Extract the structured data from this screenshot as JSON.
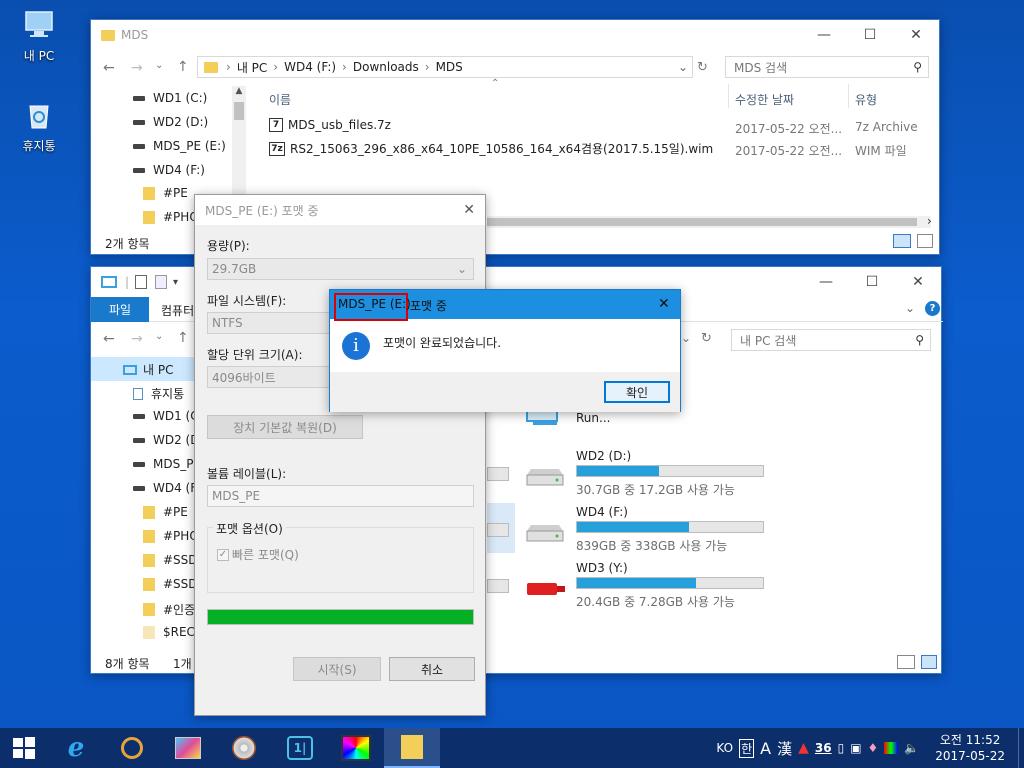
{
  "desktop": {
    "icons": [
      {
        "label": "내 PC",
        "icon": "computer-icon"
      },
      {
        "label": "휴지통",
        "icon": "recycle-bin-icon"
      }
    ]
  },
  "window_mds": {
    "title": "MDS",
    "breadcrumb": [
      "내 PC",
      "WD4 (F:)",
      "Downloads",
      "MDS"
    ],
    "search_placeholder": "MDS 검색",
    "tree": [
      {
        "label": "WD1 (C:)",
        "type": "drive"
      },
      {
        "label": "WD2 (D:)",
        "type": "drive"
      },
      {
        "label": "MDS_PE (E:)",
        "type": "drive"
      },
      {
        "label": "WD4 (F:)",
        "type": "drive"
      },
      {
        "label": "#PE",
        "type": "folder"
      },
      {
        "label": "#PHOT",
        "type": "folder"
      }
    ],
    "columns": {
      "name": "이름",
      "modified": "수정한 날짜",
      "type": "유형"
    },
    "files": [
      {
        "name": "MDS_usb_files.7z",
        "modified": "2017-05-22 오전...",
        "type": "7z Archive",
        "icon_text": "7"
      },
      {
        "name": "RS2_15063_296_x86_x64_10PE_10586_164_x64겸용(2017.5.15일).wim",
        "modified": "2017-05-22 오전...",
        "type": "WIM 파일",
        "icon_text": "7z"
      }
    ],
    "status": "2개 항목"
  },
  "window_mypc": {
    "ribbon_tabs": [
      "파일",
      "컴퓨터"
    ],
    "search_placeholder": "내 PC 검색",
    "tree": [
      {
        "label": "내 PC",
        "type": "pc"
      },
      {
        "label": "휴지통",
        "type": "bin"
      },
      {
        "label": "WD1 (C",
        "type": "drive"
      },
      {
        "label": "WD2 (D",
        "type": "drive"
      },
      {
        "label": "MDS_PE",
        "type": "drive"
      },
      {
        "label": "WD4 (F:",
        "type": "drive"
      },
      {
        "label": "#PE",
        "type": "folder"
      },
      {
        "label": "#PHOT",
        "type": "folder"
      },
      {
        "label": "#SSD1",
        "type": "folder"
      },
      {
        "label": "#SSD3",
        "type": "folder"
      },
      {
        "label": "#인증",
        "type": "folder"
      },
      {
        "label": "$RECY",
        "type": "folder"
      }
    ],
    "partial_item": "Run...",
    "drives": [
      {
        "name": "WD2 (D:)",
        "free": "30.7GB 중 17.2GB 사용 가능",
        "used_fraction": 0.44,
        "color": "#26a0da"
      },
      {
        "name": "WD4 (F:)",
        "free": "839GB 중 338GB 사용 가능",
        "used_fraction": 0.6,
        "color": "#26a0da"
      },
      {
        "name": "WD3 (Y:)",
        "free": "20.4GB 중 7.28GB 사용 가능",
        "used_fraction": 0.64,
        "color": "#26a0da"
      }
    ],
    "status_count": "8개 항목",
    "status_selected": "1개"
  },
  "format_dialog": {
    "title": "MDS_PE (E:) 포맷 중",
    "capacity_label": "용량(P):",
    "capacity_value": "29.7GB",
    "fs_label": "파일 시스템(F):",
    "fs_value": "NTFS",
    "alloc_label": "할당 단위 크기(A):",
    "alloc_value": "4096바이트",
    "restore_button": "장치 기본값 복원(D)",
    "volume_label": "볼륨 레이블(L):",
    "volume_value": "MDS_PE",
    "options_label": "포맷 옵션(O)",
    "quick_format": "빠른 포맷(Q)",
    "progress": 1.0,
    "start_button": "시작(S)",
    "cancel_button": "취소"
  },
  "message_box": {
    "title_highlight": "MDS_PE (E:)",
    "title_rest": "포맷 중",
    "message": "포맷이 완료되었습니다.",
    "ok_button": "확인"
  },
  "taskbar": {
    "tray_lang": "KO",
    "tray_ime_a": "A",
    "tray_hanja": "漢",
    "tray_number": "36",
    "clock_time": "오전 11:52",
    "clock_date": "2017-05-22"
  }
}
